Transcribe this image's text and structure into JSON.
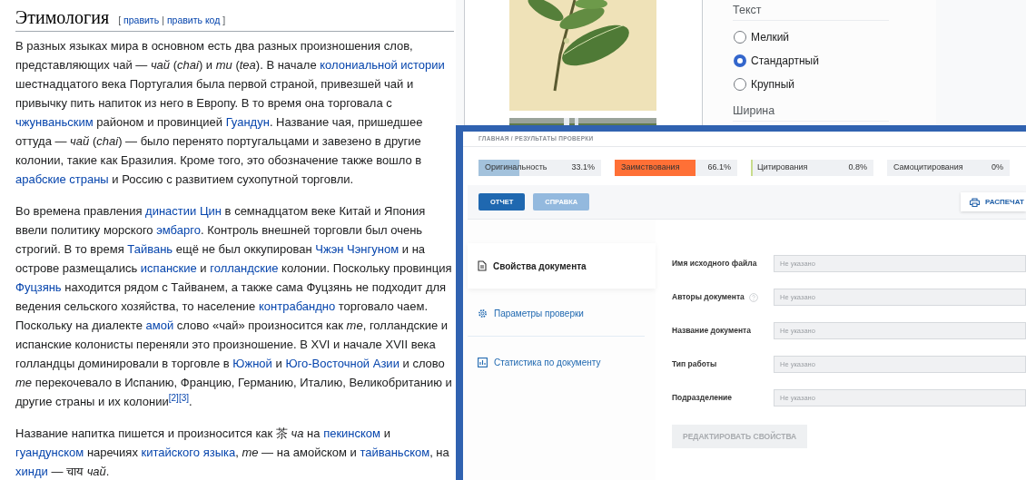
{
  "article": {
    "heading": "Этимология",
    "edit_section": {
      "open": "[",
      "links": [
        "править",
        "править код"
      ],
      "separator": "|",
      "close": "]"
    },
    "paragraphs": [
      {
        "segments": [
          {
            "kind": "text",
            "text": "В разных языках мира в основном есть два разных произношения слов, представляющих чай — *чай* (*chai*) и *ти* (*tea*). В начале "
          },
          {
            "kind": "link",
            "text": "колониальной истории"
          },
          {
            "kind": "text",
            "text": " шестнадцатого века Португалия была первой страной, привезшей чай и привычку пить напиток из него в Европу. В то время она торговала с "
          },
          {
            "kind": "link",
            "text": "чжунваньским"
          },
          {
            "kind": "text",
            "text": " районом и провинцией "
          },
          {
            "kind": "link",
            "text": "Гуандун"
          },
          {
            "kind": "text",
            "text": ". Название чая, пришедшее оттуда — *чай* (*chai*) — было перенято португальцами и завезено в другие колонии, такие как Бразилия. Кроме того, это обозначение также вошло в "
          },
          {
            "kind": "link",
            "text": "арабские страны"
          },
          {
            "kind": "text",
            "text": " и Россию с развитием сухопутной торговли."
          }
        ]
      },
      {
        "segments": [
          {
            "kind": "text",
            "text": "Во времена правления "
          },
          {
            "kind": "link",
            "text": "династии Цин"
          },
          {
            "kind": "text",
            "text": " в семнадцатом веке Китай и Япония ввели политику морского "
          },
          {
            "kind": "link",
            "text": "эмбарго"
          },
          {
            "kind": "text",
            "text": ". Контроль внешней торговли был очень строгий. В то время "
          },
          {
            "kind": "link",
            "text": "Тайвань"
          },
          {
            "kind": "text",
            "text": " ещё не был оккупирован "
          },
          {
            "kind": "link",
            "text": "Чжэн Чэнгуном"
          },
          {
            "kind": "text",
            "text": " и на острове размещались "
          },
          {
            "kind": "link",
            "text": "испанские"
          },
          {
            "kind": "text",
            "text": " и "
          },
          {
            "kind": "link",
            "text": "голландские"
          },
          {
            "kind": "text",
            "text": " колонии. Поскольку провинция "
          },
          {
            "kind": "link",
            "text": "Фуцзянь"
          },
          {
            "kind": "text",
            "text": " находится рядом с Тайванем, а также сама Фуцзянь не подходит для ведения сельского хозяйства, то население "
          },
          {
            "kind": "link",
            "text": "контрабандно"
          },
          {
            "kind": "text",
            "text": " торговало чаем. Поскольку на диалекте "
          },
          {
            "kind": "link",
            "text": "амой"
          },
          {
            "kind": "text",
            "text": " слово «чай» произносится как *те*, голландские и испанские колонисты переняли это произношение. В XVI и начале XVII века голландцы доминировали в торговле в "
          },
          {
            "kind": "link",
            "text": "Южной"
          },
          {
            "kind": "text",
            "text": " и "
          },
          {
            "kind": "link",
            "text": "Юго-Восточной Азии"
          },
          {
            "kind": "text",
            "text": " и слово *те* перекочевало в Испанию, Францию, Германию, Италию, Великобританию и другие страны и их колонии"
          },
          {
            "kind": "ref",
            "text": "[2]"
          },
          {
            "kind": "ref",
            "text": "[3]"
          },
          {
            "kind": "text",
            "text": "."
          }
        ]
      },
      {
        "segments": [
          {
            "kind": "text",
            "text": "Название напитка пишется и произносится как 茶 *ча* на "
          },
          {
            "kind": "link",
            "text": "пекинском"
          },
          {
            "kind": "text",
            "text": " и "
          },
          {
            "kind": "link",
            "text": "гуандунском"
          },
          {
            "kind": "text",
            "text": " наречиях "
          },
          {
            "kind": "link",
            "text": "китайского языка"
          },
          {
            "kind": "text",
            "text": ", *те* — на амойском и "
          },
          {
            "kind": "link",
            "text": "тайваньском"
          },
          {
            "kind": "text",
            "text": ", на "
          },
          {
            "kind": "link",
            "text": "хинди"
          },
          {
            "kind": "text",
            "text": " — चाय *чай*."
          }
        ]
      }
    ]
  },
  "background_page": {
    "settings": {
      "text_section": "Текст",
      "options": [
        {
          "label": "Мелкий",
          "selected": false
        },
        {
          "label": "Стандартный",
          "selected": true
        },
        {
          "label": "Крупный",
          "selected": false
        }
      ],
      "width_section": "Ширина"
    }
  },
  "report_window": {
    "breadcrumb": "ГЛАВНАЯ / РЕЗУЛЬТАТЫ ПРОВЕРКИ",
    "stats": [
      {
        "label": "Оригинальность",
        "value": "33.1%",
        "level": 0.331,
        "color": "#a3c2dc"
      },
      {
        "label": "Заимствования",
        "value": "66.1%",
        "level": 0.661,
        "color": "#ff7036"
      },
      {
        "label": "Цитирования",
        "value": "0.8%",
        "level": 0.008,
        "color": "#c8dc8c"
      },
      {
        "label": "Самоцитирования",
        "value": "0%"
      }
    ],
    "tabs": [
      {
        "label": "ОТЧЕТ",
        "selected": true
      },
      {
        "label": "СПРАВКА",
        "selected": false
      }
    ],
    "print_button": "РАСПЕЧАТ",
    "nav": [
      {
        "label": "Свойства документа",
        "selected": true
      },
      {
        "label": "Параметры проверки",
        "selected": false
      },
      {
        "label": "Статистика по документу",
        "selected": false
      }
    ],
    "fields": [
      {
        "label": "Имя исходного файла",
        "placeholder": "Не указано",
        "help": false
      },
      {
        "label": "Авторы документа",
        "placeholder": "Не указано",
        "help": true
      },
      {
        "label": "Название документа",
        "placeholder": "Не указано",
        "help": false
      },
      {
        "label": "Тип работы",
        "placeholder": "Не указано",
        "help": false
      },
      {
        "label": "Подразделение",
        "placeholder": "Не указано",
        "help": false
      }
    ],
    "edit_button": {
      "label": "РЕДАКТИРОВАТЬ СВОЙСТВА",
      "disabled": true
    }
  }
}
